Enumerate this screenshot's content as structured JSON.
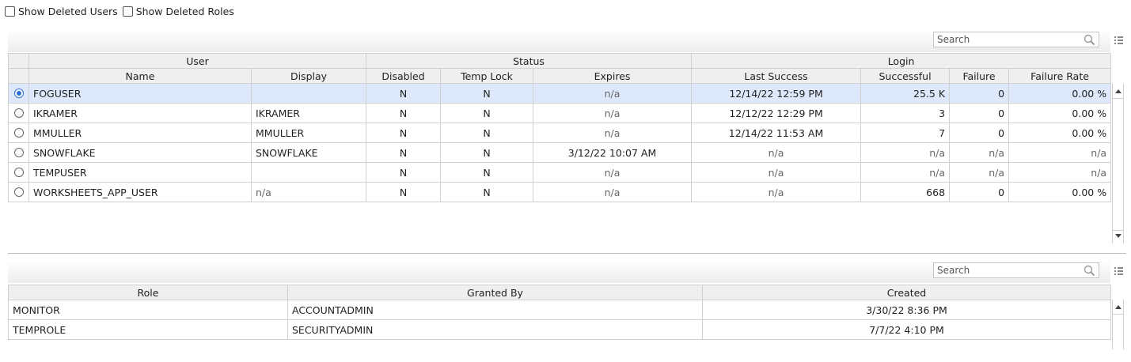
{
  "filters": {
    "show_deleted_users": "Show Deleted Users",
    "show_deleted_roles": "Show Deleted Roles"
  },
  "users_panel": {
    "search_placeholder": "Search",
    "group_headers": {
      "user": "User",
      "status": "Status",
      "login": "Login"
    },
    "columns": {
      "name": "Name",
      "display": "Display",
      "disabled": "Disabled",
      "temp_lock": "Temp Lock",
      "expires": "Expires",
      "last_success": "Last Success",
      "successful": "Successful",
      "failure": "Failure",
      "failure_rate": "Failure Rate"
    },
    "rows": [
      {
        "name": "FOGUSER",
        "display": "",
        "disabled": "N",
        "temp_lock": "N",
        "expires": "n/a",
        "last_success": "12/14/22 12:59 PM",
        "successful": "25.5 K",
        "failure": "0",
        "failure_rate": "0.00 %"
      },
      {
        "name": "IKRAMER",
        "display": "IKRAMER",
        "disabled": "N",
        "temp_lock": "N",
        "expires": "n/a",
        "last_success": "12/12/22 12:29 PM",
        "successful": "3",
        "failure": "0",
        "failure_rate": "0.00 %"
      },
      {
        "name": "MMULLER",
        "display": "MMULLER",
        "disabled": "N",
        "temp_lock": "N",
        "expires": "n/a",
        "last_success": "12/14/22 11:53 AM",
        "successful": "7",
        "failure": "0",
        "failure_rate": "0.00 %"
      },
      {
        "name": "SNOWFLAKE",
        "display": "SNOWFLAKE",
        "disabled": "N",
        "temp_lock": "N",
        "expires": "3/12/22 10:07 AM",
        "last_success": "n/a",
        "successful": "n/a",
        "failure": "n/a",
        "failure_rate": "n/a"
      },
      {
        "name": "TEMPUSER",
        "display": "",
        "disabled": "N",
        "temp_lock": "N",
        "expires": "n/a",
        "last_success": "n/a",
        "successful": "n/a",
        "failure": "n/a",
        "failure_rate": "n/a"
      },
      {
        "name": "WORKSHEETS_APP_USER",
        "display": "n/a",
        "disabled": "N",
        "temp_lock": "N",
        "expires": "n/a",
        "last_success": "n/a",
        "successful": "668",
        "failure": "0",
        "failure_rate": "0.00 %"
      }
    ],
    "selected_row": "FOGUSER"
  },
  "roles_panel": {
    "search_placeholder": "Search",
    "columns": {
      "role": "Role",
      "granted_by": "Granted By",
      "created": "Created"
    },
    "rows": [
      {
        "role": "MONITOR",
        "granted_by": "ACCOUNTADMIN",
        "created": "3/30/22 8:36 PM"
      },
      {
        "role": "TEMPROLE",
        "granted_by": "SECURITYADMIN",
        "created": "7/7/22 4:10 PM"
      }
    ]
  },
  "colors": {
    "selected_row": "#dde8fb",
    "header_bg": "#efefef",
    "radio_accent": "#2a6fd6"
  },
  "icons": {
    "search": "magnifier-icon",
    "column_menu": "column-menu-icon",
    "scroll_up": "scroll-up-arrow",
    "scroll_down": "scroll-down-arrow"
  }
}
